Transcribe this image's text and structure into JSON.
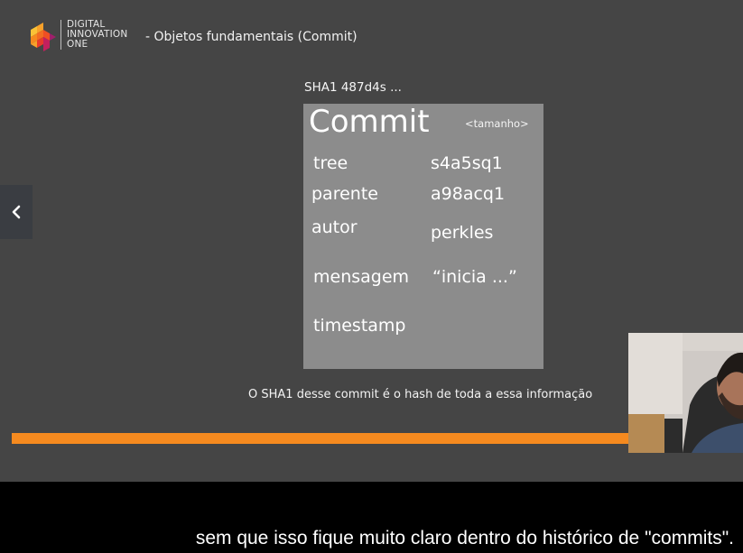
{
  "brand": {
    "lines": [
      "DIGITAL",
      "INNOVATION",
      "ONE"
    ],
    "orange": "#f58a1f"
  },
  "header": {
    "title": "- Objetos fundamentais (Commit)"
  },
  "slide": {
    "sha_label": "SHA1 487d4s ...",
    "commit": {
      "title": "Commit",
      "size": "<tamanho>",
      "fields": [
        {
          "key": "tree",
          "value": "s4a5sq1"
        },
        {
          "key": "parente",
          "value": "a98acq1"
        },
        {
          "key": "autor",
          "value": "perkles"
        },
        {
          "key": "mensagem",
          "value": "“inicia ...”"
        },
        {
          "key": "timestamp",
          "value": ""
        }
      ]
    },
    "caption": "O SHA1 desse commit é o hash de toda a essa informação"
  },
  "player": {
    "prev_icon": "chevron-left-icon"
  },
  "subtitle": "sem que isso fique muito claro dentro do histórico de \"commits\"."
}
